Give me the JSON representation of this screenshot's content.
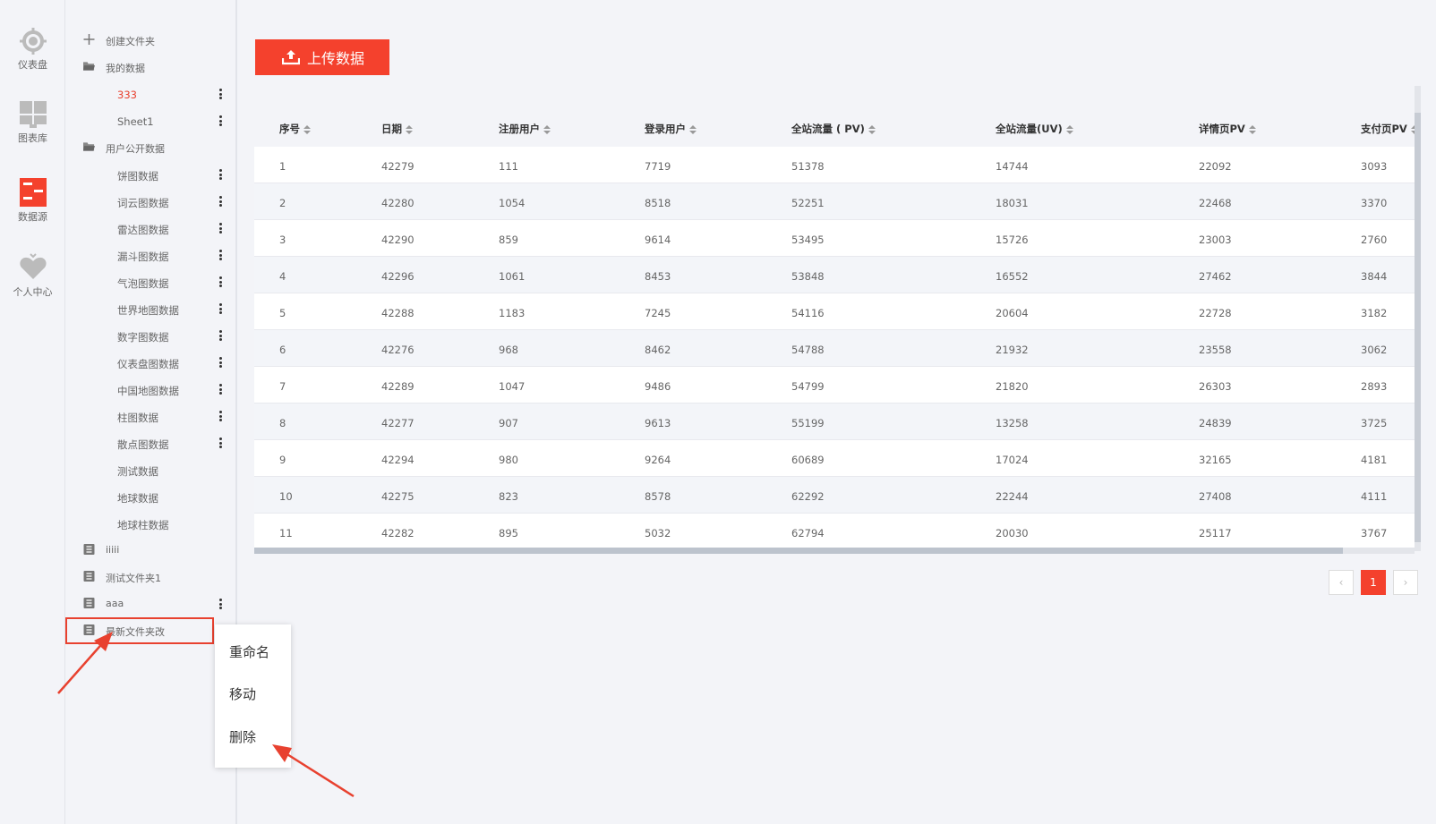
{
  "rail": {
    "items": [
      {
        "label": "仪表盘",
        "icon": "dashboard-gauge-icon"
      },
      {
        "label": "图表库",
        "icon": "chart-library-icon"
      },
      {
        "label": "数据源",
        "icon": "data-source-icon"
      },
      {
        "label": "个人中心",
        "icon": "user-heart-icon"
      }
    ],
    "active_color": "#f4412d"
  },
  "tree": {
    "create_folder": "创建文件夹",
    "my_data": {
      "label": "我的数据",
      "children": [
        "333",
        "Sheet1"
      ]
    },
    "public_data": {
      "label": "用户公开数据",
      "children": [
        "饼图数据",
        "词云图数据",
        "雷达图数据",
        "漏斗图数据",
        "气泡图数据",
        "世界地图数据",
        "数字图数据",
        "仪表盘图数据",
        "中国地图数据",
        "柱图数据",
        "散点图数据",
        "测试数据",
        "地球数据",
        "地球柱数据"
      ]
    },
    "folders": [
      "iiiii",
      "测试文件夹1",
      "aaa",
      "最新文件夹改"
    ]
  },
  "context_menu": {
    "rename": "重命名",
    "move": "移动",
    "delete": "删除"
  },
  "upload_button": "上传数据",
  "table": {
    "columns": [
      "序号",
      "日期",
      "注册用户",
      "登录用户",
      "全站流量 ( PV)",
      "全站流量(UV)",
      "详情页PV",
      "支付页PV"
    ],
    "rows": [
      [
        "1",
        "42279",
        "111",
        "7719",
        "51378",
        "14744",
        "22092",
        "3093"
      ],
      [
        "2",
        "42280",
        "1054",
        "8518",
        "52251",
        "18031",
        "22468",
        "3370"
      ],
      [
        "3",
        "42290",
        "859",
        "9614",
        "53495",
        "15726",
        "23003",
        "2760"
      ],
      [
        "4",
        "42296",
        "1061",
        "8453",
        "53848",
        "16552",
        "27462",
        "3844"
      ],
      [
        "5",
        "42288",
        "1183",
        "7245",
        "54116",
        "20604",
        "22728",
        "3182"
      ],
      [
        "6",
        "42276",
        "968",
        "8462",
        "54788",
        "21932",
        "23558",
        "3062"
      ],
      [
        "7",
        "42289",
        "1047",
        "9486",
        "54799",
        "21820",
        "26303",
        "2893"
      ],
      [
        "8",
        "42277",
        "907",
        "9613",
        "55199",
        "13258",
        "24839",
        "3725"
      ],
      [
        "9",
        "42294",
        "980",
        "9264",
        "60689",
        "17024",
        "32165",
        "4181"
      ],
      [
        "10",
        "42275",
        "823",
        "8578",
        "62292",
        "22244",
        "27408",
        "4111"
      ],
      [
        "11",
        "42282",
        "895",
        "5032",
        "62794",
        "20030",
        "25117",
        "3767"
      ]
    ]
  },
  "pagination": {
    "prev": "‹",
    "current": "1",
    "next": "›"
  }
}
